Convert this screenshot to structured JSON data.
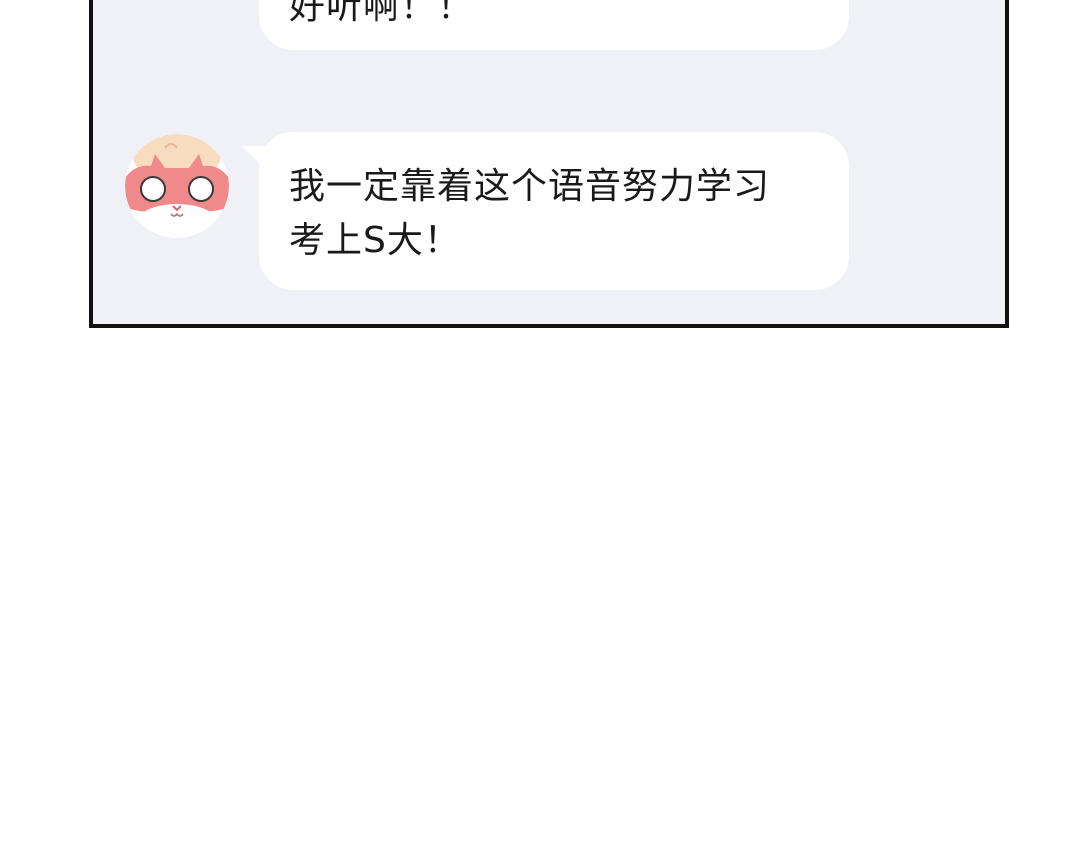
{
  "messages": [
    {
      "lines": [
        "好听啊！！"
      ]
    },
    {
      "lines": [
        "我一定靠着这个语音努力学习",
        "考上S大！"
      ]
    }
  ],
  "colors": {
    "panel_background": "#eff1f7",
    "panel_border": "#111111",
    "bubble_background": "#ffffff",
    "text": "#1a1a1a",
    "avatar_pink": "#f08a8a",
    "avatar_cream": "#f7dcc0"
  },
  "icons": {
    "avatar": "pink-animal-avatar-icon"
  }
}
